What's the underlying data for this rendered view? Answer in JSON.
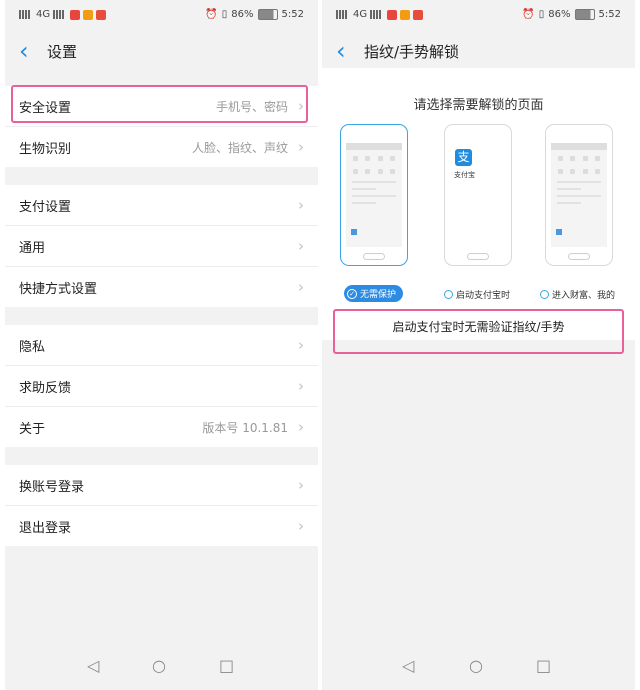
{
  "status_bar": {
    "network": "4G",
    "battery": "86%",
    "time": "5:52"
  },
  "left": {
    "title": "设置",
    "groups": [
      [
        {
          "label": "安全设置",
          "value": "手机号、密码"
        },
        {
          "label": "生物识别",
          "value": "人脸、指纹、声纹"
        }
      ],
      [
        {
          "label": "支付设置",
          "value": ""
        },
        {
          "label": "通用",
          "value": ""
        },
        {
          "label": "快捷方式设置",
          "value": ""
        }
      ],
      [
        {
          "label": "隐私",
          "value": ""
        },
        {
          "label": "求助反馈",
          "value": ""
        },
        {
          "label": "关于",
          "value": "版本号 10.1.81"
        }
      ],
      [
        {
          "label": "换账号登录",
          "value": ""
        },
        {
          "label": "退出登录",
          "value": ""
        }
      ]
    ]
  },
  "right": {
    "title": "指纹/手势解锁",
    "prompt": "请选择需要解锁的页面",
    "alipay_label": "支付宝",
    "options": [
      {
        "label": "无需保护",
        "selected": true
      },
      {
        "label": "启动支付宝时",
        "selected": false
      },
      {
        "label": "进入财富、我的",
        "selected": false
      }
    ],
    "description": "启动支付宝时无需验证指纹/手势"
  },
  "colors": {
    "accent": "#1f8ce0",
    "highlight": "#e8619a",
    "background": "#f2f2f2"
  }
}
